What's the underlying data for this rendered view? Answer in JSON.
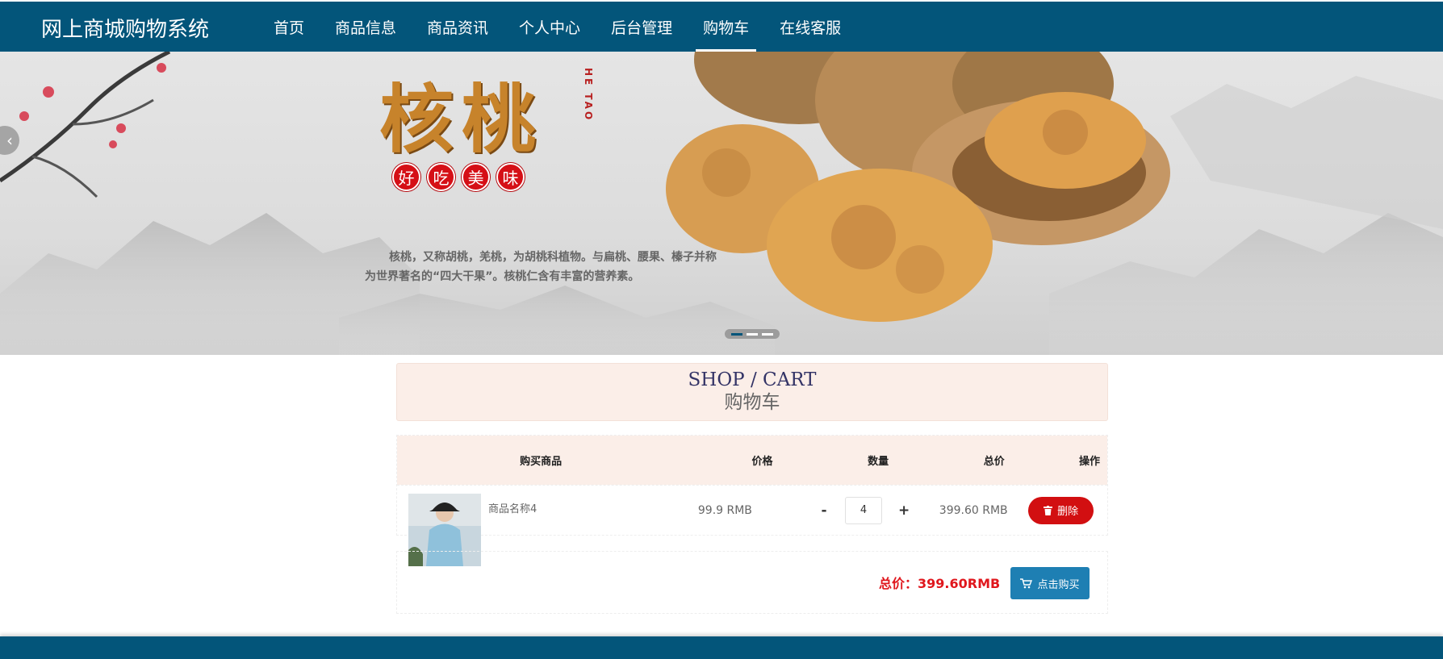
{
  "brand": {
    "title": "网上商城购物系统"
  },
  "nav": {
    "items": [
      {
        "label": "首页"
      },
      {
        "label": "商品信息"
      },
      {
        "label": "商品资讯"
      },
      {
        "label": "个人中心"
      },
      {
        "label": "后台管理"
      },
      {
        "label": "购物车",
        "active": true
      },
      {
        "label": "在线客服"
      }
    ]
  },
  "banner": {
    "title": "核桃",
    "pinyin": "HE TAO",
    "seals": [
      "好",
      "吃",
      "美",
      "味"
    ],
    "description": "核桃，又称胡桃，羌桃，为胡桃科植物。与扁桃、腰果、榛子并称为世界著名的“四大干果”。核桃仁含有丰富的营养素。",
    "slide_count": 3,
    "active_slide": 1
  },
  "section": {
    "title_en": "SHOP / CART",
    "title_cn": "购物车"
  },
  "cart": {
    "headers": {
      "product": "购买商品",
      "price": "价格",
      "quantity": "数量",
      "total": "总价",
      "action": "操作"
    },
    "items": [
      {
        "name": "商品名称4",
        "price": "99.9 RMB",
        "quantity": "4",
        "total": "399.60 RMB",
        "delete_label": "删除"
      }
    ],
    "qty_minus": "-",
    "qty_plus": "+",
    "grand_total": "总价：399.60RMB",
    "buy_label": "点击购买"
  },
  "colors": {
    "nav_bg": "#03557a",
    "delete_btn": "#d20f11",
    "buy_btn": "#1e7fb3",
    "total_text": "#e0171d",
    "header_bg": "#fbeee8"
  }
}
